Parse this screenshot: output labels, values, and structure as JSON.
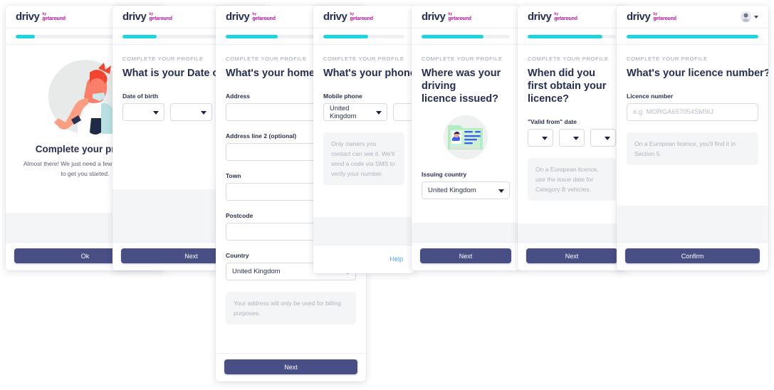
{
  "brand": {
    "logo_main": "drivy",
    "logo_by": "by",
    "logo_getaround": "getaround"
  },
  "colors": {
    "progress": "#1ad6de",
    "progress_track": "#eef0f2",
    "button": "#474f85",
    "heading": "#272e53",
    "link": "#4aa3f0",
    "logo_main": "#272e53",
    "logo_accent": "#b4199b",
    "note_bg": "#f4f5f7"
  },
  "common": {
    "eyebrow": "COMPLETE YOUR PROFILE"
  },
  "cards": [
    {
      "id": "welcome",
      "progress": 14,
      "has_avatar": false,
      "hero_title": "Complete your profile",
      "hero_sub_line1": "Almost there! We just need a few more details",
      "hero_sub_line2": "to get you started.",
      "button": "Ok"
    },
    {
      "id": "date-of-birth",
      "progress": 25,
      "has_avatar": false,
      "question": "What is your Date of Birth?",
      "field_label": "Date of birth",
      "selects": [
        "",
        "",
        ""
      ],
      "button": "Next"
    },
    {
      "id": "home-address",
      "progress": 40,
      "has_avatar": false,
      "question": "What's your home address?",
      "fields": [
        {
          "label": "Address",
          "value": ""
        },
        {
          "label": "Address line 2 (optional)",
          "value": ""
        },
        {
          "label": "Town",
          "value": ""
        },
        {
          "label": "Postcode",
          "value": ""
        }
      ],
      "country_label": "Country",
      "country_value": "United Kingdom",
      "note": "Your address will only be used for billing purposes.",
      "button": "Next"
    },
    {
      "id": "phone-number",
      "progress": 55,
      "has_avatar": false,
      "question": "What's your phone number?",
      "field_label": "Mobile phone",
      "country_value": "United Kingdom",
      "phone_value": "",
      "note": "Only owners you contact can see it. We'll send a code via SMS to verify your number.",
      "footer_link": "Help"
    },
    {
      "id": "licence-issued",
      "progress": 70,
      "has_avatar": false,
      "question_line1": "Where was your driving",
      "question_line2": "licence issued?",
      "field_label": "Issuing country",
      "country_value": "United Kingdom",
      "button": "Next"
    },
    {
      "id": "licence-date",
      "progress": 85,
      "has_avatar": false,
      "question_line1": "When did you first obtain your",
      "question_line2": "licence?",
      "field_label": "\"Valid from\" date",
      "selects": [
        "",
        "",
        ""
      ],
      "note": "On a European licence, use the issue date for Category B vehicles.",
      "button": "Next"
    },
    {
      "id": "licence-number",
      "progress": 100,
      "has_avatar": true,
      "question": "What's your licence number?",
      "field_label": "Licence number",
      "placeholder": "e.g. MORGA657054SM9IJ",
      "note": "On a European licence, you'll find it in Section 5.",
      "button": "Confirm"
    }
  ]
}
